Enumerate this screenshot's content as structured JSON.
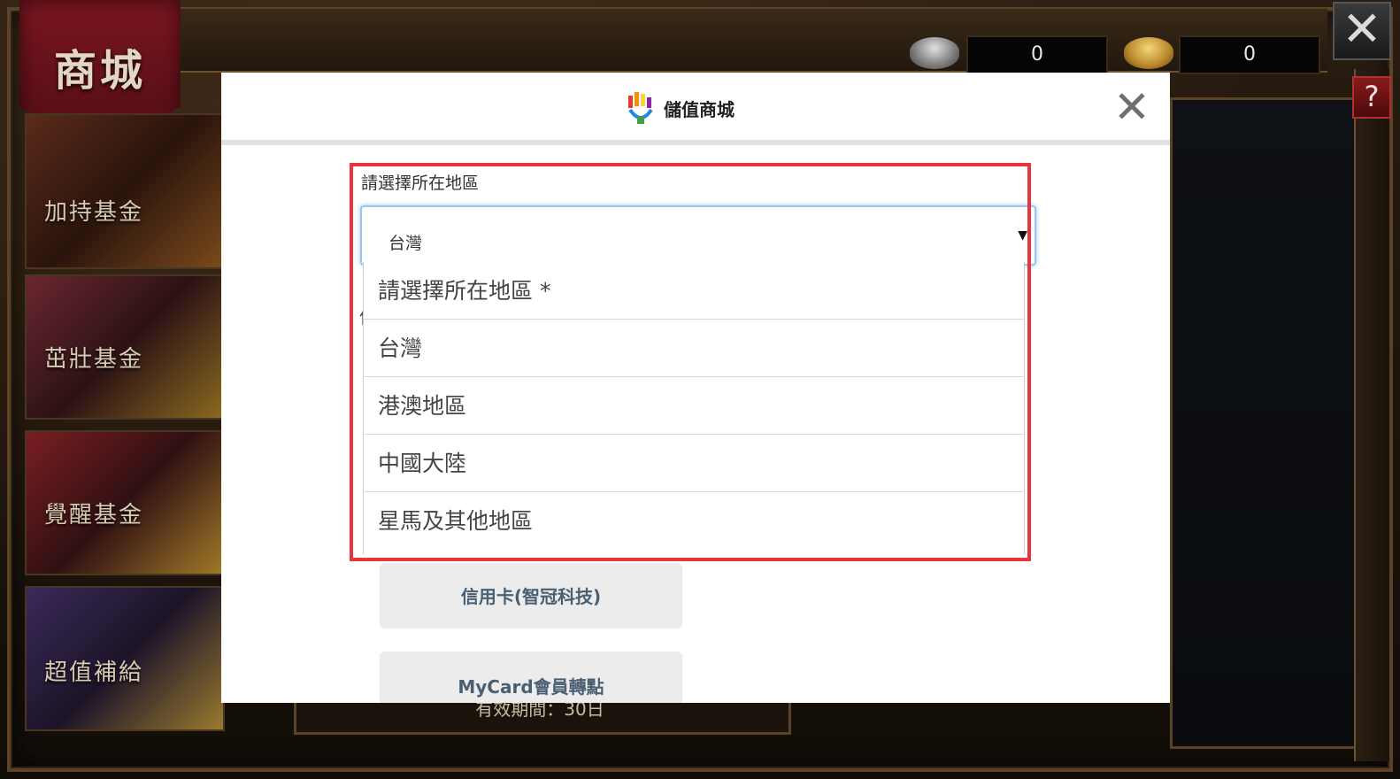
{
  "game": {
    "shop_badge": "商城",
    "side_tabs": [
      {
        "label": "加持基金"
      },
      {
        "label": "茁壯基金"
      },
      {
        "label": "覺醒基金"
      },
      {
        "label": "超值補給"
      }
    ],
    "silver_amount": "0",
    "gold_amount": "0",
    "close_glyph": "✕",
    "help_glyph": "?",
    "bottom_text": "有效期間：30日"
  },
  "modal": {
    "title": "儲值商城",
    "close_glyph": "✕",
    "logo_icon": "brand-logo-icon",
    "region_label": "請選擇所在地區",
    "select": {
      "current_value": "台灣",
      "arrow_glyph": "▼"
    },
    "dropdown_options": [
      "請選擇所在地區 *",
      "台灣",
      "港澳地區",
      "中國大陸",
      "星馬及其他地區"
    ],
    "hidden_char": "信",
    "payment_buttons": [
      {
        "label": "信用卡(智冠科技)"
      },
      {
        "label": "MyCard會員轉點"
      }
    ],
    "highlight_color": "#e8343d"
  }
}
